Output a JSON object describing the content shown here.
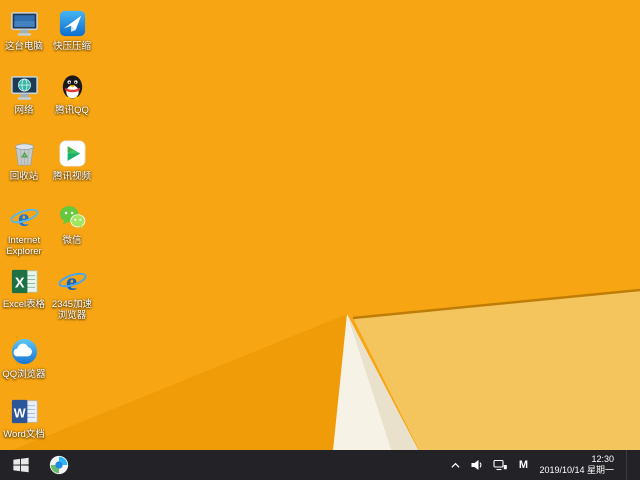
{
  "wallpaper": {
    "base": "#F7A512",
    "shade_left": "#F09C08",
    "light_triangle": "#F3C55C",
    "wedge": "#F7F2E6",
    "wedge_shadow": "#E9E1CC",
    "edge_line": "#BF7D08"
  },
  "desktop": {
    "column1": [
      {
        "label": "这台电脑"
      },
      {
        "label": "网络"
      },
      {
        "label": "回收站"
      },
      {
        "label": "Internet Explorer"
      },
      {
        "label": "Excel表格"
      },
      {
        "label": "QQ浏览器"
      },
      {
        "label": "Word文档"
      }
    ],
    "column2": [
      {
        "label": "快压压缩"
      },
      {
        "label": "腾讯QQ"
      },
      {
        "label": "腾讯视频"
      },
      {
        "label": "微信"
      },
      {
        "label": "2345加速浏览器"
      }
    ]
  },
  "taskbar": {
    "ime_label": "M",
    "clock": {
      "time": "12:30",
      "date": "2019/10/14 星期一"
    }
  }
}
